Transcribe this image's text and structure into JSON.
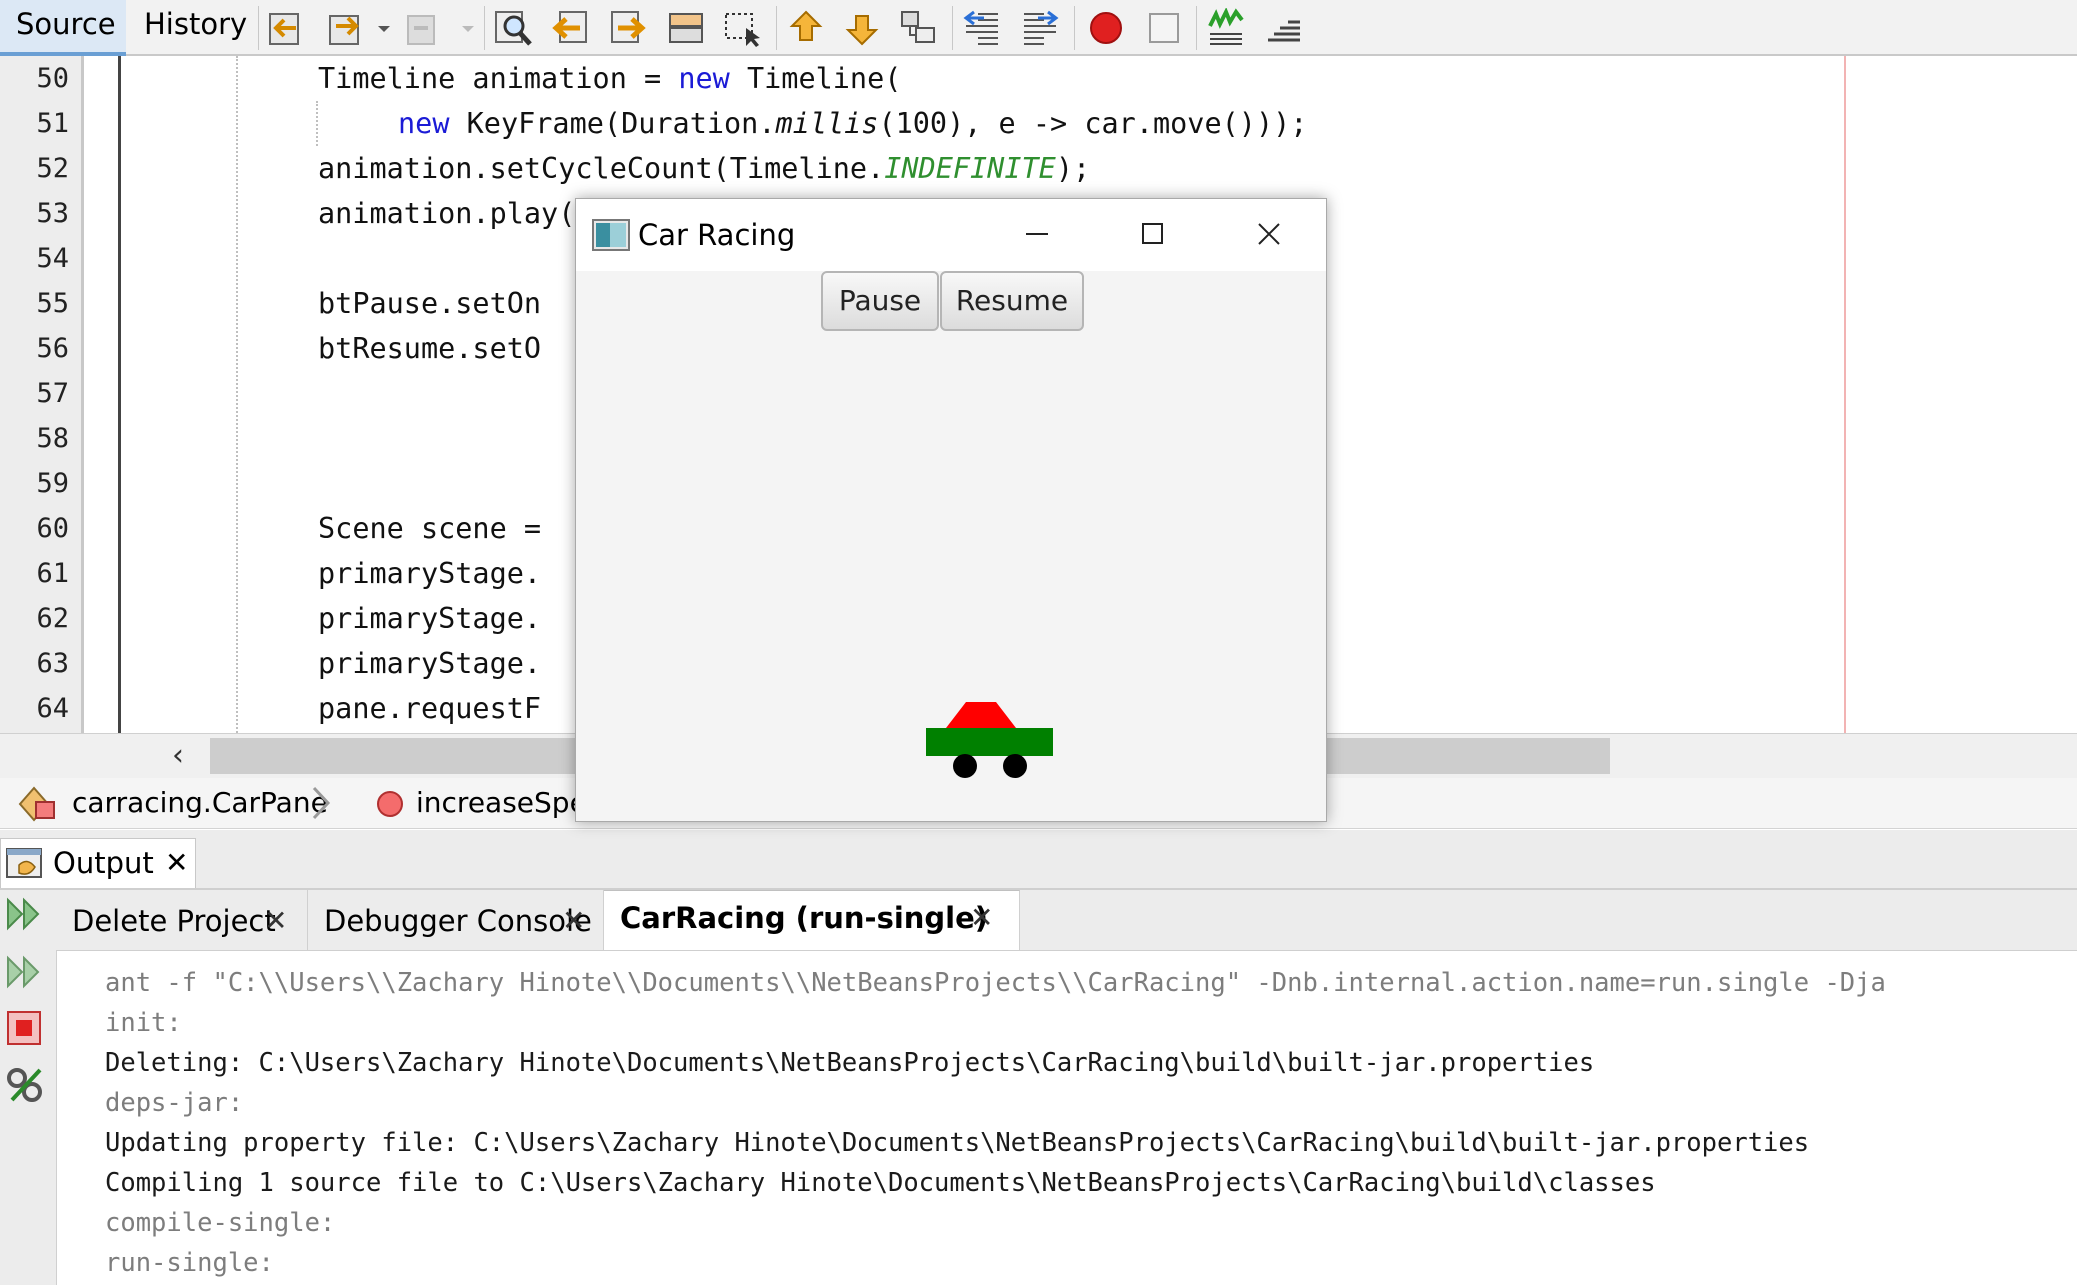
{
  "editor": {
    "tabs": {
      "source": "Source",
      "history": "History"
    },
    "toolbar_icons": [
      "back-icon",
      "forward-icon",
      "dropdown-icon",
      "disabled-icon",
      "dropdown-icon",
      "search-icon",
      "prev-occurrence-icon",
      "next-occurrence-icon",
      "toggle-highlight-icon",
      "select-rect-icon",
      "prev-bookmark-icon",
      "next-bookmark-icon",
      "toggle-bookmark-icon",
      "shift-left-icon",
      "shift-right-icon",
      "record-macro-icon",
      "stop-macro-icon",
      "check-icon",
      "comment-icon"
    ],
    "line_numbers": [
      "50",
      "51",
      "52",
      "53",
      "54",
      "55",
      "56",
      "57",
      "58",
      "59",
      "60",
      "61",
      "62",
      "63",
      "64"
    ],
    "code": {
      "l50": {
        "a": "Timeline animation = ",
        "kw": "new",
        "b": " Timeline("
      },
      "l51": {
        "kw": "new",
        "a": " KeyFrame(Duration.",
        "it": "millis",
        "b": "(100), e -> car.move()));"
      },
      "l52": {
        "a": "animation.setCycleCount(Timeline.",
        "const": "INDEFINITE",
        "b": ");"
      },
      "l53": "animation.play();",
      "l55": "btPause.setOn",
      "l56": "btResume.setO",
      "l60": "Scene scene =",
      "l61": "primaryStage.",
      "l62": "primaryStage.",
      "l63": "primaryStage.",
      "l64": "pane.requestF"
    },
    "breadcrumb": {
      "class": "carracing.CarPane",
      "method": "increaseSpee"
    }
  },
  "output": {
    "title": "Output",
    "tabs": [
      {
        "label": "Delete Project"
      },
      {
        "label": "Debugger Console"
      },
      {
        "label": "CarRacing (run-single)"
      }
    ],
    "console_lines": [
      "ant -f \"C:\\\\Users\\\\Zachary Hinote\\\\Documents\\\\NetBeansProjects\\\\CarRacing\" -Dnb.internal.action.name=run.single -Dja",
      "init:",
      "Deleting: C:\\Users\\Zachary Hinote\\Documents\\NetBeansProjects\\CarRacing\\build\\built-jar.properties",
      "deps-jar:",
      "Updating property file: C:\\Users\\Zachary Hinote\\Documents\\NetBeansProjects\\CarRacing\\build\\built-jar.properties",
      "Compiling 1 source file to C:\\Users\\Zachary Hinote\\Documents\\NetBeansProjects\\CarRacing\\build\\classes",
      "compile-single:",
      "run-single:"
    ]
  },
  "car_window": {
    "title": "Car Racing",
    "pause_label": "Pause",
    "resume_label": "Resume",
    "colors": {
      "roof": "#ff0000",
      "body": "#008000",
      "wheels": "#000000"
    }
  }
}
